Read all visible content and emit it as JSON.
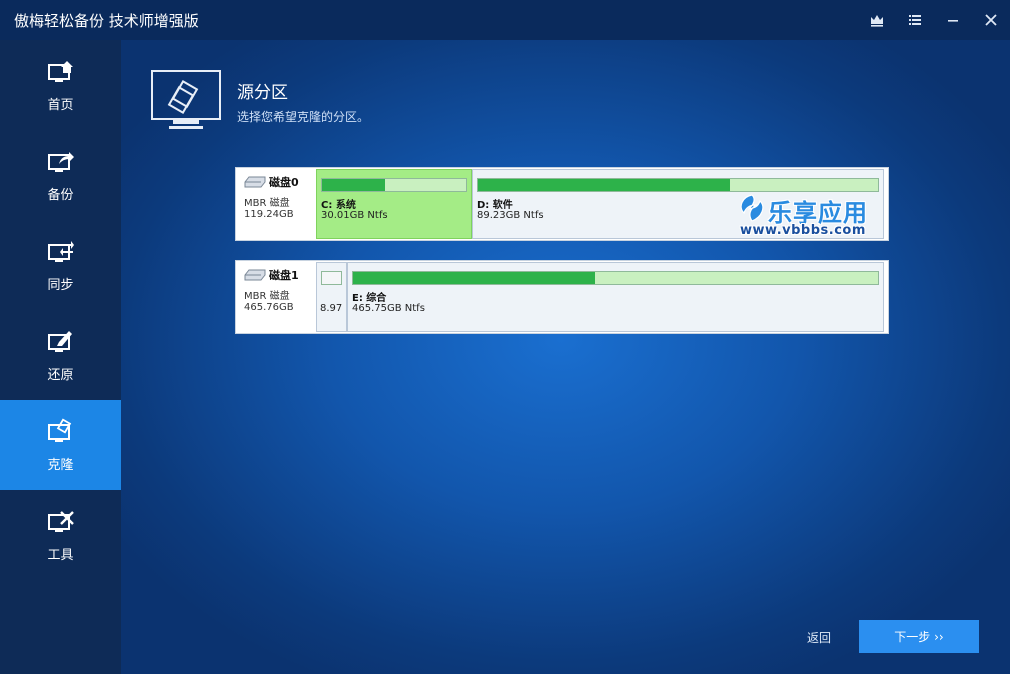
{
  "window": {
    "title": "傲梅轻松备份 技术师增强版",
    "controls": [
      "crown-icon",
      "menu-icon",
      "minimize-icon",
      "close-icon"
    ]
  },
  "sidebar": {
    "items": [
      {
        "label": "首页",
        "icon": "home-monitor-icon",
        "active": false
      },
      {
        "label": "备份",
        "icon": "backup-monitor-icon",
        "active": false
      },
      {
        "label": "同步",
        "icon": "sync-monitor-icon",
        "active": false
      },
      {
        "label": "还原",
        "icon": "restore-monitor-icon",
        "active": false
      },
      {
        "label": "克隆",
        "icon": "clone-monitor-icon",
        "active": true
      },
      {
        "label": "工具",
        "icon": "tools-monitor-icon",
        "active": false
      }
    ]
  },
  "header": {
    "title": "源分区",
    "subtitle": "选择您希望克隆的分区。"
  },
  "disks": [
    {
      "name": "磁盘0",
      "type": "MBR 磁盘",
      "size": "119.24GB",
      "partitions": [
        {
          "name": "C: 系统",
          "size": "30.01GB Ntfs",
          "used_fraction": 0.44,
          "selected": true
        },
        {
          "name": "D: 软件",
          "size": "89.23GB Ntfs",
          "used_fraction": 0.63,
          "selected": false
        }
      ]
    },
    {
      "name": "磁盘1",
      "type": "MBR 磁盘",
      "size": "465.76GB",
      "partitions": [
        {
          "name": "",
          "size": "8.97",
          "used_fraction": 0.0,
          "selected": false
        },
        {
          "name": "E: 综合",
          "size": "465.75GB Ntfs",
          "used_fraction": 0.46,
          "selected": false
        }
      ]
    }
  ],
  "watermark": {
    "text_cn": "乐享应用",
    "text_en": "www.vbbbs.com"
  },
  "footer": {
    "back_label": "返回",
    "next_label": "下一步 ››"
  },
  "colors": {
    "accent": "#2b8ff0",
    "sidebar_active": "#1c86e6",
    "used_fill": "#2db24a",
    "selected_partition": "#a4ec86"
  }
}
